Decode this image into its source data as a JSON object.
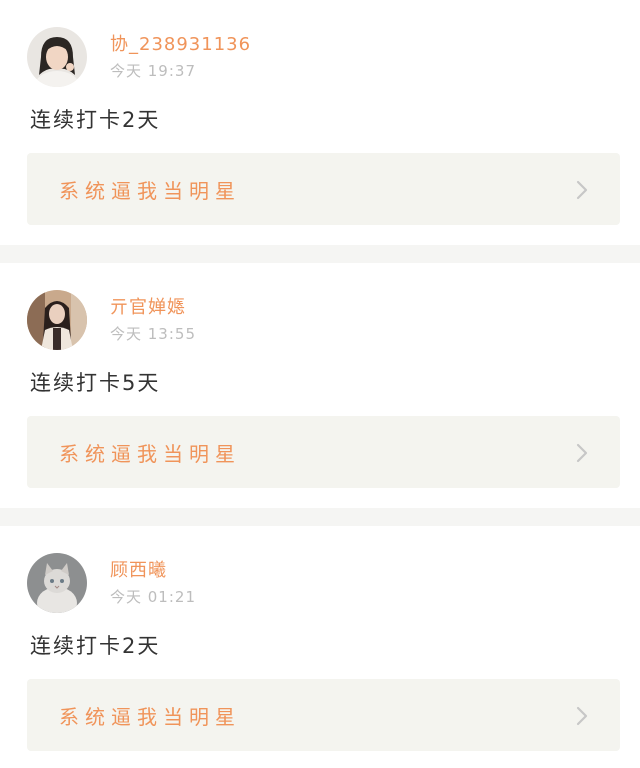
{
  "posts": [
    {
      "username": "协_238931136",
      "time": "今天 19:37",
      "text": "连续打卡2天",
      "link_label": "系统逼我当明星"
    },
    {
      "username": "亓官婵嫕",
      "time": "今天 13:55",
      "text": "连续打卡5天",
      "link_label": "系统逼我当明星"
    },
    {
      "username": "顾西曦",
      "time": "今天 01:21",
      "text": "连续打卡2天",
      "link_label": "系统逼我当明星"
    }
  ],
  "icons": {
    "link_arrow": "chevron-right-icon"
  },
  "colors": {
    "accent": "#f0945a",
    "timestamp": "#bdbdbd",
    "body_text": "#333333",
    "card_background": "#f4f4ef",
    "divider": "#f5f5f3"
  }
}
